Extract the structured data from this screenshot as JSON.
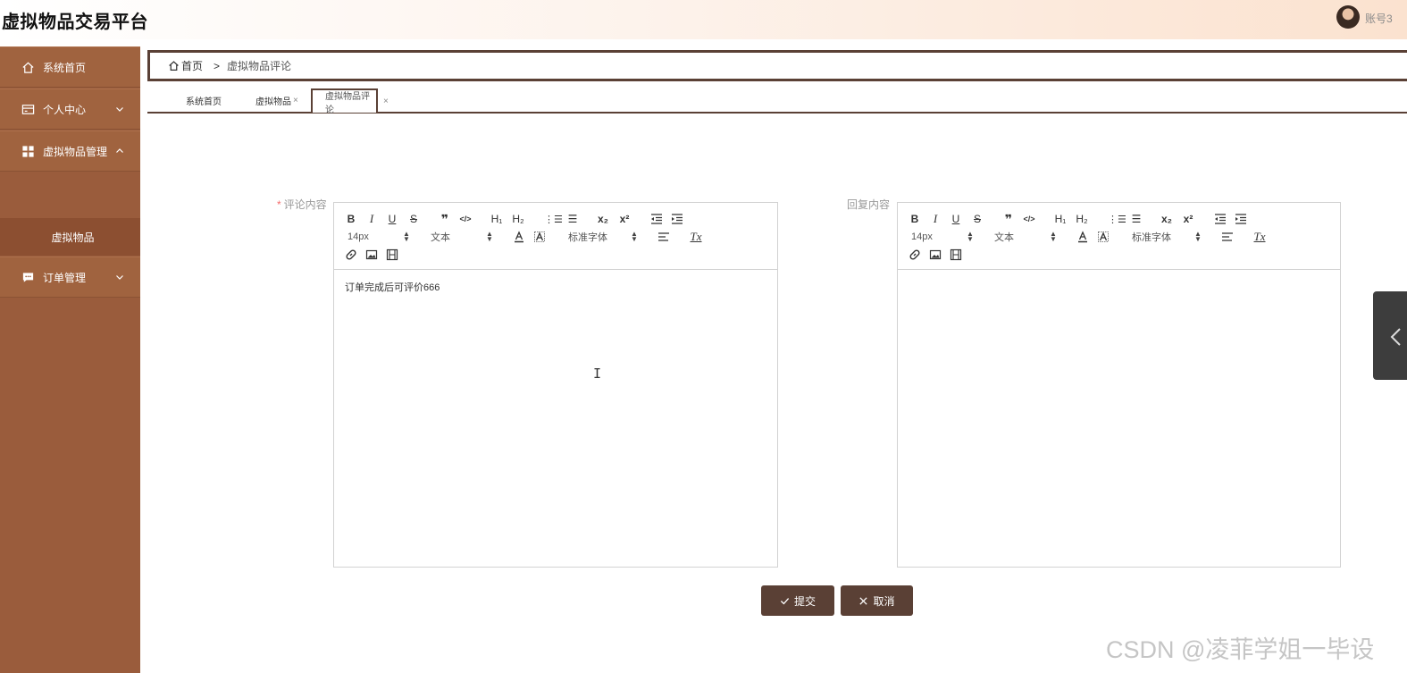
{
  "header": {
    "app_title": "虚拟物品交易平台",
    "account_name": "账号3"
  },
  "sidebar": {
    "items": [
      {
        "label": "系统首页",
        "icon": "home-icon"
      },
      {
        "label": "个人中心",
        "icon": "card-icon",
        "chevron": "down"
      },
      {
        "label": "虚拟物品管理",
        "icon": "grid-icon",
        "chevron": "up"
      },
      {
        "label": "订单管理",
        "icon": "chat-icon",
        "chevron": "down"
      }
    ],
    "sub_items": [
      {
        "label": "虚拟物品"
      }
    ]
  },
  "breadcrumb": {
    "home": "首页",
    "separator": ">",
    "current": "虚拟物品评论"
  },
  "tabs": [
    {
      "label": "系统首页",
      "closable": false
    },
    {
      "label": "虚拟物品",
      "closable": true
    },
    {
      "label": "虚拟物品评论",
      "closable": true,
      "active": true
    }
  ],
  "tab_close_glyph": "×",
  "form": {
    "comment": {
      "required_mark": "*",
      "label": "评论内容",
      "content": "订单完成后可评价666"
    },
    "reply": {
      "label": "回复内容",
      "content": ""
    }
  },
  "editor_toolbar": {
    "bold": "B",
    "italic": "I",
    "underline": "U",
    "strike": "S",
    "quote": "❞",
    "code": "</>",
    "h1": "H₁",
    "h2": "H₂",
    "ordered_list": "⋮☰",
    "bullet_list": "☰",
    "subscript": "x₂",
    "superscript": "x²",
    "size_value": "14px",
    "text_type_value": "文本",
    "font_value": "标准字体",
    "clean": "Tx",
    "icons": [
      "bold-icon",
      "italic-icon",
      "underline-icon",
      "strike-icon",
      "blockquote-icon",
      "code-icon",
      "h1-icon",
      "h2-icon",
      "ordered-list-icon",
      "bullet-list-icon",
      "subscript-icon",
      "superscript-icon",
      "outdent-icon",
      "indent-icon",
      "font-color-icon",
      "background-color-icon",
      "align-icon",
      "clear-format-icon",
      "link-icon",
      "image-icon",
      "video-icon"
    ]
  },
  "buttons": {
    "submit": "提交",
    "cancel": "取消"
  },
  "watermark": "CSDN @凌菲学姐一毕设",
  "colors": {
    "sidebar": "#9a5c3c",
    "sidebar_active_sub": "#8c4f31",
    "accent_dark": "#5a4035",
    "required": "#f56c6c"
  }
}
